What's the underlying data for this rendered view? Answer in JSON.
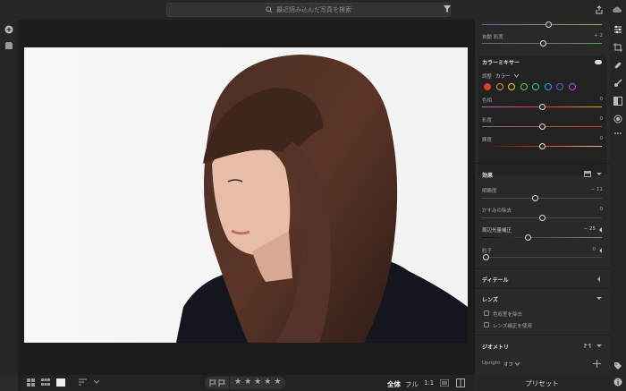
{
  "search": {
    "placeholder": "最近読み込んだ写真を検索"
  },
  "right_panel": {
    "auto_saturation": {
      "label": "自動 彩度",
      "value": "+ 2"
    },
    "color_mixer": {
      "title": "カラーミキサー",
      "adjust_label": "調整",
      "adjust_value": "カラー",
      "swatches": [
        "#e03a2a",
        "#e58a2a",
        "#e5d02a",
        "#6fcc2a",
        "#2ac88a",
        "#2a9ae5",
        "#6a5ae5",
        "#b84ae0"
      ],
      "hue": {
        "label": "色相",
        "value": "0"
      },
      "saturation": {
        "label": "彩度",
        "value": "0"
      },
      "luminance": {
        "label": "輝度",
        "value": "0"
      }
    },
    "effects": {
      "title": "効果",
      "clarity": {
        "label": "明瞭度",
        "value": "− 11",
        "fraction": 0.42
      },
      "dehaze": {
        "label": "かすみの除去",
        "value": "0",
        "fraction": 0.5
      },
      "vignette": {
        "label": "周辺光量補正",
        "value": "− 25",
        "fraction": 0.38
      },
      "grain": {
        "label": "粒子",
        "value": "0",
        "fraction": 0.0
      }
    },
    "detail": {
      "title": "ディテール"
    },
    "lens": {
      "title": "レンズ",
      "remove_ca": "色収差を除去",
      "enable_lens": "レンズ補正を使用"
    },
    "geometry": {
      "title": "ジオメトリ",
      "upright_label": "Upright",
      "upright_value": "オフ"
    }
  },
  "bottom_bar": {
    "zoom_fit": "全体",
    "zoom_full": "フル",
    "zoom_1to1": "1:1",
    "rating_stars": 5
  },
  "preset_button": "プリセット",
  "colors": {
    "accent": "#ffffff",
    "panel": "#292929",
    "viewer": "#1c1c1c"
  }
}
